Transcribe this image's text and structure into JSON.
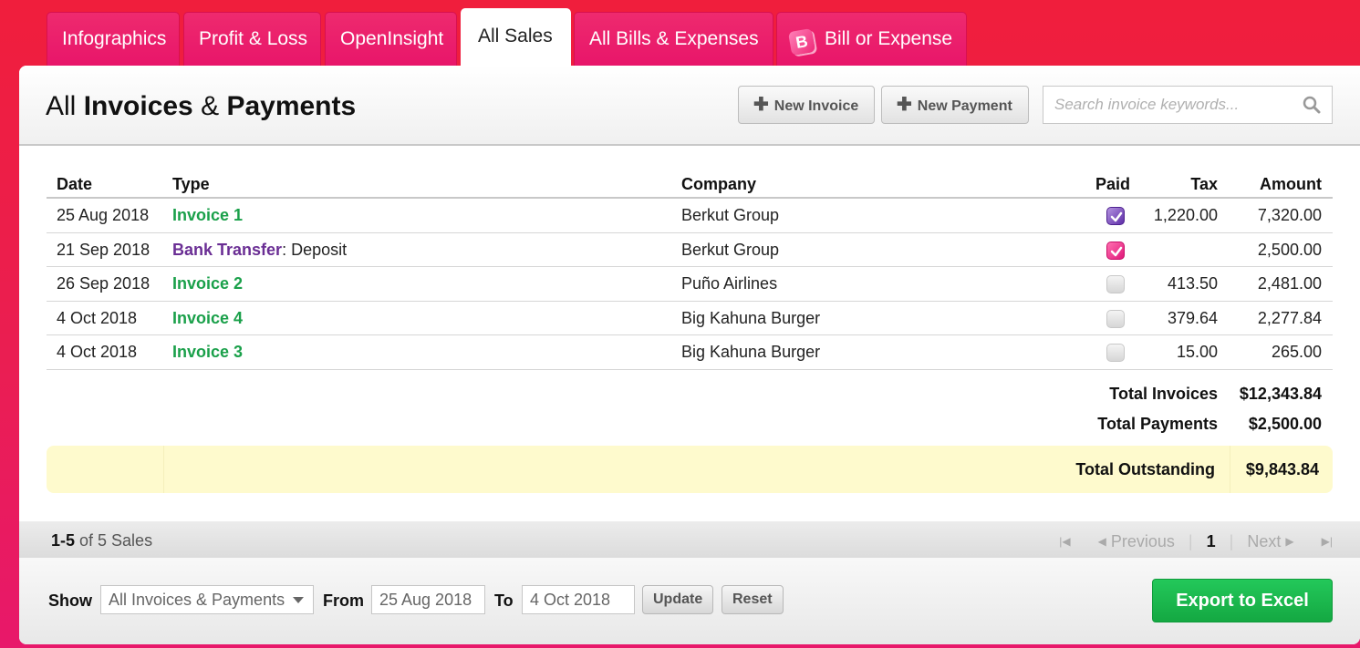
{
  "tabs": [
    {
      "label": "Infographics"
    },
    {
      "label": "Profit & Loss"
    },
    {
      "label": "OpenInsight"
    },
    {
      "label": "All Sales",
      "active": true
    },
    {
      "label": "All Bills & Expenses"
    },
    {
      "label": "Bill or Expense",
      "icon": "B"
    }
  ],
  "header": {
    "title_prefix": "All ",
    "title_part1": "Invoices",
    "title_amp": " & ",
    "title_part2": "Payments",
    "new_invoice_label": "New Invoice",
    "new_payment_label": "New Payment",
    "search_placeholder": "Search invoice keywords..."
  },
  "table": {
    "columns": [
      "Date",
      "Type",
      "Company",
      "Paid",
      "Tax",
      "Amount"
    ],
    "rows": [
      {
        "date": "25 Aug 2018",
        "type_link": "Invoice 1",
        "type_suffix": "",
        "kind": "invoice",
        "company": "Berkut Group",
        "paid": "purple",
        "tax": "1,220.00",
        "amount": "7,320.00"
      },
      {
        "date": "21 Sep 2018",
        "type_link": "Bank Transfer",
        "type_suffix": ": Deposit",
        "kind": "payment",
        "company": "Berkut Group",
        "paid": "pink",
        "tax": "",
        "amount": "2,500.00"
      },
      {
        "date": "26 Sep 2018",
        "type_link": "Invoice 2",
        "type_suffix": "",
        "kind": "invoice",
        "company": "Puño Airlines",
        "paid": "empty",
        "tax": "413.50",
        "amount": "2,481.00"
      },
      {
        "date": "4 Oct 2018",
        "type_link": "Invoice 4",
        "type_suffix": "",
        "kind": "invoice",
        "company": "Big Kahuna Burger",
        "paid": "empty",
        "tax": "379.64",
        "amount": "2,277.84"
      },
      {
        "date": "4 Oct 2018",
        "type_link": "Invoice 3",
        "type_suffix": "",
        "kind": "invoice",
        "company": "Big Kahuna Burger",
        "paid": "empty",
        "tax": "15.00",
        "amount": "265.00"
      }
    ]
  },
  "totals": {
    "invoices_label": "Total Invoices",
    "invoices_value": "$12,343.84",
    "payments_label": "Total Payments",
    "payments_value": "$2,500.00",
    "outstanding_label": "Total Outstanding",
    "outstanding_value": "$9,843.84"
  },
  "pagination": {
    "range": "1-5",
    "of_text": " of 5 Sales",
    "previous": "Previous",
    "current": "1",
    "next": "Next"
  },
  "footer": {
    "show_label": "Show",
    "show_value": "All Invoices & Payments",
    "from_label": "From",
    "from_value": "25 Aug 2018",
    "to_label": "To",
    "to_value": "4 Oct 2018",
    "update_label": "Update",
    "reset_label": "Reset",
    "export_label": "Export to Excel"
  },
  "colors": {
    "background": "#f01e3c",
    "tab": "#e8156a",
    "invoice_link": "#1aa04a",
    "payment_link": "#6a2e94",
    "export_button": "#1cb84e",
    "outstanding_bg": "#fefacd"
  }
}
